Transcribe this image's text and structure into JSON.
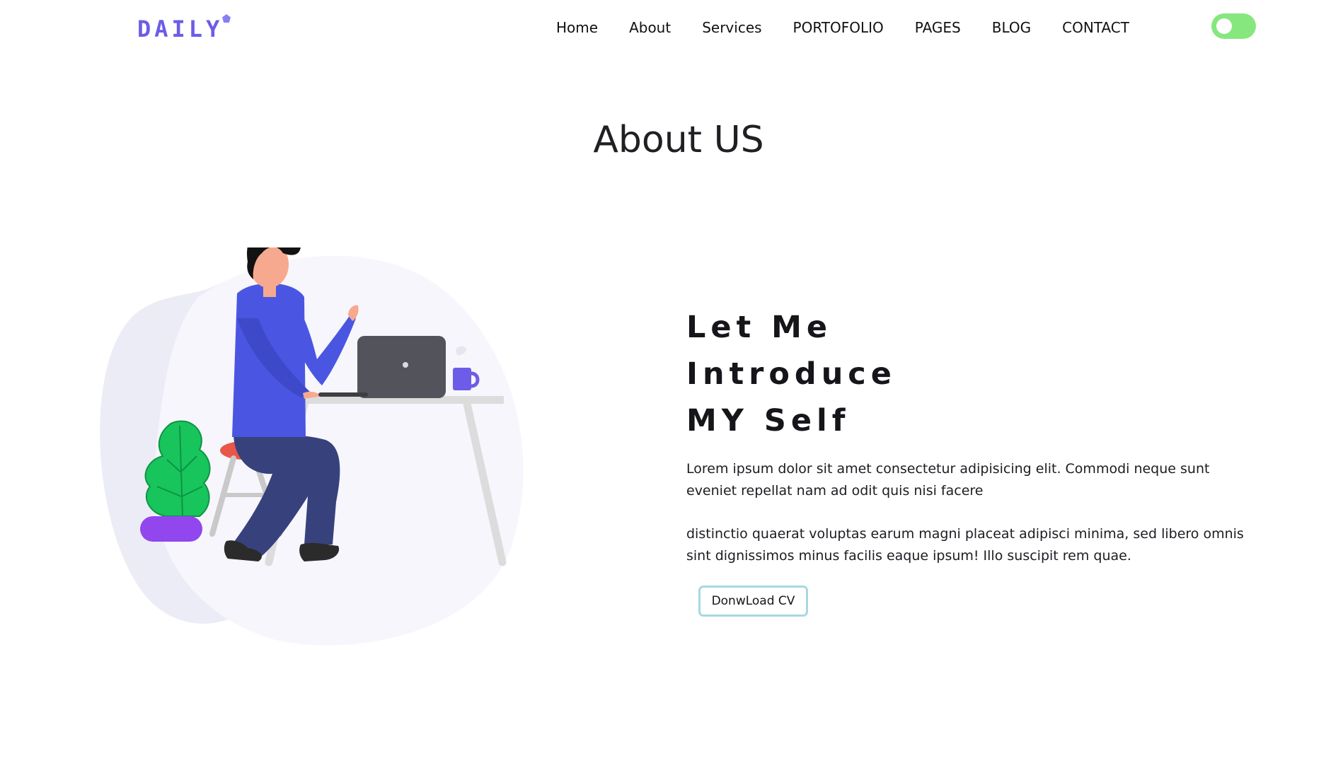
{
  "header": {
    "logo_text": "DAILY",
    "nav": [
      "Home",
      "About",
      "Services",
      "PORTOFOLIO",
      "PAGES",
      "BLOG",
      "CONTACT"
    ],
    "theme_toggle": {
      "state": "on",
      "color": "#86e77e"
    }
  },
  "about": {
    "title": "About US",
    "heading_lines": [
      "Let Me",
      "Introduce",
      "MY Self"
    ],
    "paragraphs": [
      "Lorem ipsum dolor sit amet consectetur adipisicing elit. Commodi neque sunt eveniet repellat nam ad odit quis nisi facere",
      "distinctio quaerat voluptas earum magni placeat adipisci minima, sed libero omnis sint dignissimos minus facilis eaque ipsum! Illo suscipit rem quae."
    ],
    "button_label": "DonwLoad CV"
  },
  "colors": {
    "brand": "#6c5ce7",
    "toggle": "#86e77e",
    "button_border": "#a7d8e4",
    "figure_shirt": "#4a56e2",
    "plant_pot": "#9146ee",
    "plant_leaf": "#17c55c"
  },
  "icons": [
    "logo-pentagon-icon"
  ]
}
